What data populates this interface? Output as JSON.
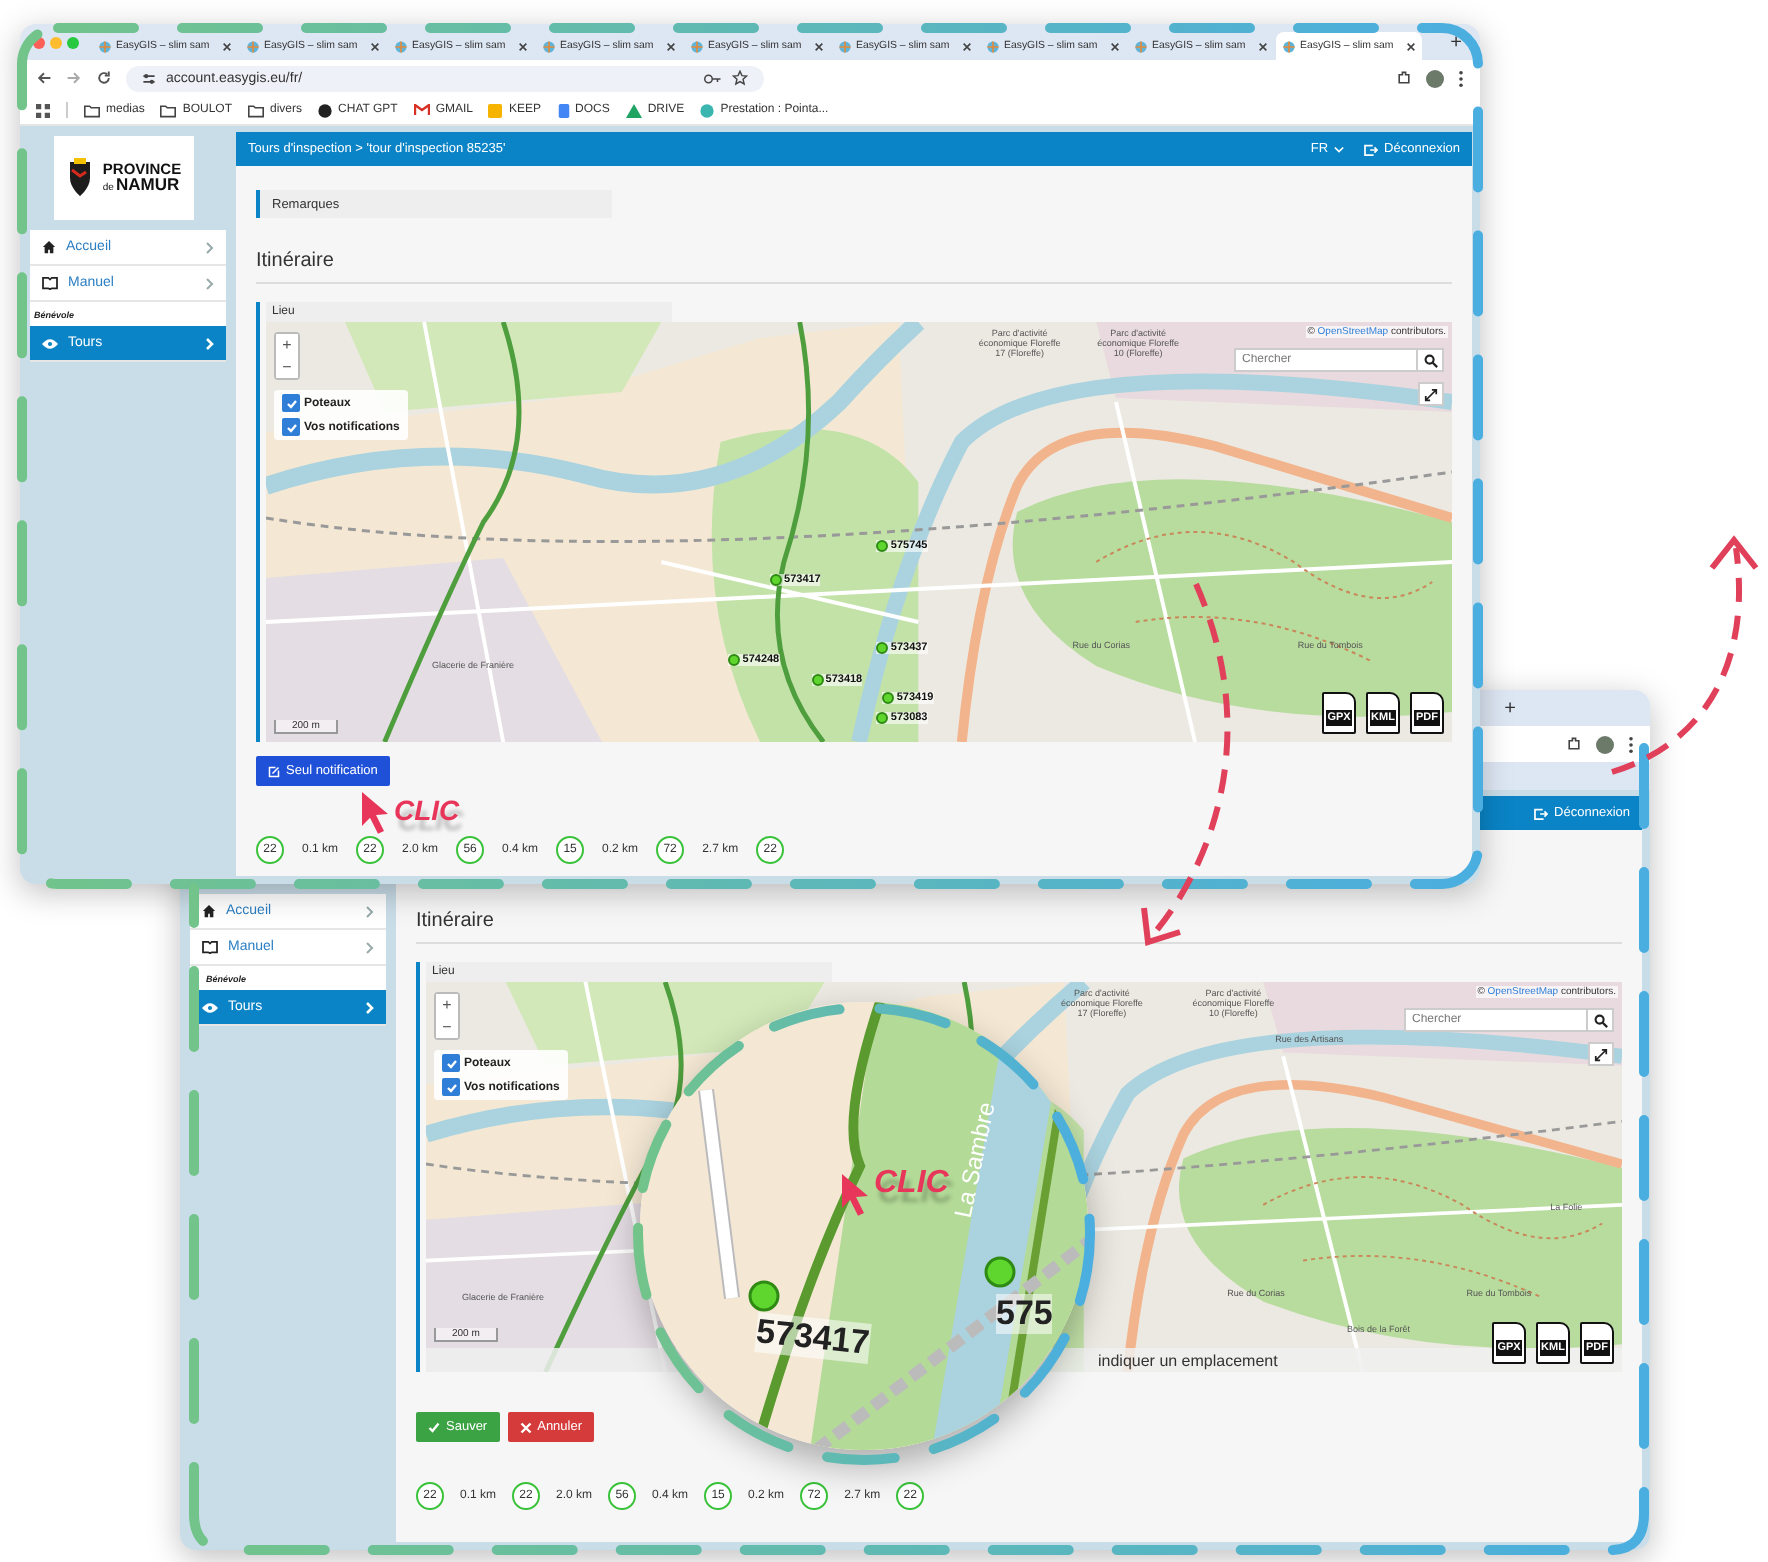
{
  "windows": [
    {
      "kind": "front",
      "browser": {
        "tabs": [
          {
            "title": "EasyGIS – slim sam",
            "selected": false
          },
          {
            "title": "EasyGIS – slim sam",
            "selected": false
          },
          {
            "title": "EasyGIS – slim sam",
            "selected": false
          },
          {
            "title": "EasyGIS – slim sam",
            "selected": false
          },
          {
            "title": "EasyGIS – slim sam",
            "selected": false
          },
          {
            "title": "EasyGIS – slim sam",
            "selected": false
          },
          {
            "title": "EasyGIS – slim sam",
            "selected": false
          },
          {
            "title": "EasyGIS – slim sam",
            "selected": false
          },
          {
            "title": "EasyGIS – slim sam",
            "selected": true
          }
        ],
        "new_tab": "+",
        "address": "account.easygis.eu/fr/",
        "bookmarks": [
          {
            "label": "medias",
            "kind": "folder"
          },
          {
            "label": "BOULOT",
            "kind": "folder"
          },
          {
            "label": "divers",
            "kind": "folder"
          },
          {
            "label": "CHAT GPT",
            "kind": "chatgpt"
          },
          {
            "label": "GMAIL",
            "kind": "gmail"
          },
          {
            "label": "KEEP",
            "kind": "keep"
          },
          {
            "label": "DOCS",
            "kind": "docs"
          },
          {
            "label": "DRIVE",
            "kind": "drive"
          },
          {
            "label": "Prestation : Pointa...",
            "kind": "site"
          }
        ]
      },
      "logo": {
        "top": "PROVINCE",
        "small": "de",
        "bottom": "NAMUR"
      },
      "sidebar": {
        "items": [
          {
            "label": "Accueil",
            "kind": "home",
            "selected": false
          },
          {
            "label": "Manuel",
            "kind": "book",
            "selected": false
          }
        ],
        "section": "Bénévole",
        "section_items": [
          {
            "label": "Tours",
            "kind": "eye",
            "selected": true
          }
        ]
      },
      "header": {
        "breadcrumb": "Tours d'inspection > 'tour d'inspection 85235'",
        "language": "FR",
        "logout": "Déconnexion"
      },
      "remarks": "Remarques",
      "title": "Itinéraire",
      "map": {
        "label": "Lieu",
        "zoom_in": "+",
        "zoom_out": "−",
        "layers": [
          {
            "label": "Poteaux",
            "checked": true
          },
          {
            "label": "Vos notifications",
            "checked": true
          }
        ],
        "attribution": {
          "prefix": "©",
          "link": "OpenStreetMap",
          "suffix": "contributors."
        },
        "search_placeholder": "Chercher",
        "scale": "200 m",
        "markers": [
          "575745",
          "573417",
          "574248",
          "573437",
          "573418",
          "573419",
          "573083"
        ],
        "places": [
          "Glacerie de Franière",
          "Parc d'activité économique Floreffe 17 (Floreffe)",
          "Parc d'activité économique Floreffe 10 (Floreffe)",
          "Rue du Corias",
          "Rue du Tombois"
        ],
        "exports": [
          "GPX",
          "KML",
          "PDF"
        ]
      },
      "buttons": [
        {
          "label": "Seul notification",
          "kind": "notify"
        }
      ],
      "annotation": "CLIC",
      "route": [
        {
          "badge": "22",
          "distance": "0.1 km"
        },
        {
          "badge": "22",
          "distance": "2.0 km"
        },
        {
          "badge": "56",
          "distance": "0.4 km"
        },
        {
          "badge": "15",
          "distance": "0.2 km"
        },
        {
          "badge": "72",
          "distance": "2.7 km"
        },
        {
          "badge": "22"
        }
      ]
    },
    {
      "kind": "back",
      "browser": {
        "new_tab": "+"
      },
      "sidebar": {
        "items": [
          {
            "label": "Accueil",
            "kind": "home",
            "selected": false
          },
          {
            "label": "Manuel",
            "kind": "book",
            "selected": false
          }
        ],
        "section": "Bénévole",
        "section_items": [
          {
            "label": "Tours",
            "kind": "eye",
            "selected": true
          }
        ]
      },
      "header": {
        "logout": "Déconnexion"
      },
      "title": "Itinéraire",
      "map": {
        "label": "Lieu",
        "zoom_in": "+",
        "zoom_out": "−",
        "layers": [
          {
            "label": "Poteaux",
            "checked": true
          },
          {
            "label": "Vos notifications",
            "checked": true
          }
        ],
        "attribution": {
          "prefix": "©",
          "link": "OpenStreetMap",
          "suffix": "contributors."
        },
        "search_placeholder": "Chercher",
        "scale": "200 m",
        "places": [
          "Glacerie de Franière",
          "Parc d'activité économique Floreffe 17 (Floreffe)",
          "Parc d'activité économique Floreffe 10 (Floreffe)",
          "Rue des Artisans",
          "Rue du Corias",
          "Rue du Tombois",
          "La Folie",
          "Bois de la Forêt"
        ],
        "hint": "indiquer un emplacement",
        "exports": [
          "GPX",
          "KML",
          "PDF"
        ]
      },
      "magnifier": {
        "markers": [
          "573417",
          "575"
        ],
        "river": "La Sambre",
        "annotation": "CLIC"
      },
      "buttons": [
        {
          "label": "Sauver",
          "kind": "save"
        },
        {
          "label": "Annuler",
          "kind": "cancel"
        }
      ],
      "route": [
        {
          "badge": "22",
          "distance": "0.1 km"
        },
        {
          "badge": "22",
          "distance": "2.0 km"
        },
        {
          "badge": "56",
          "distance": "0.4 km"
        },
        {
          "badge": "15",
          "distance": "0.2 km"
        },
        {
          "badge": "72",
          "distance": "2.7 km"
        },
        {
          "badge": "22"
        }
      ]
    }
  ]
}
